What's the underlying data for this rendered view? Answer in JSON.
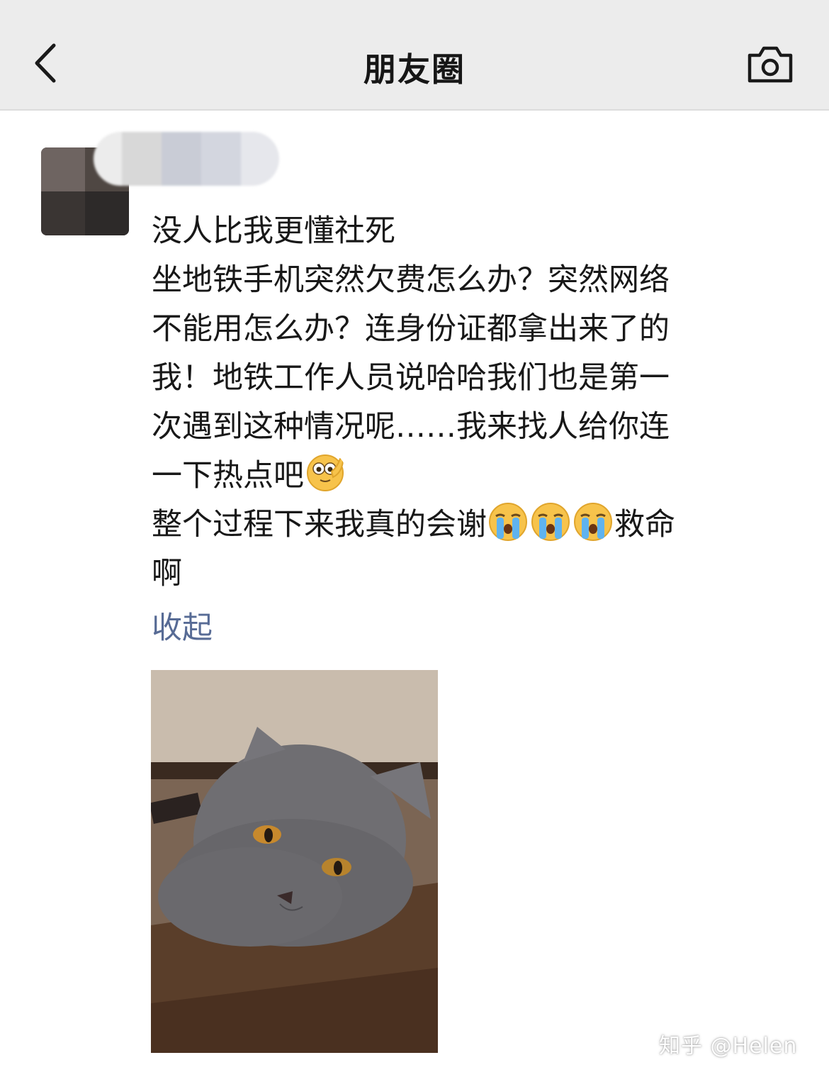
{
  "header": {
    "title": "朋友圈",
    "back_icon": "back-chevron-icon",
    "camera_icon": "camera-icon"
  },
  "post": {
    "lines": [
      "没人比我更懂社死",
      "坐地铁手机突然欠费怎么办？突然网络",
      "不能用怎么办？连身份证都拿出来了的",
      "我！地铁工作人员说哈哈我们也是第一",
      "次遇到这种情况呢……我来找人给你连",
      "一下热点吧",
      "整个过程下来我真的会谢",
      "救命",
      "啊"
    ],
    "emojis": [
      "thinking-salute-emoji",
      "crying-emoji"
    ],
    "collapse_label": "收起",
    "photo": "gray-cat-photo"
  },
  "watermark": "知乎 @Helen"
}
